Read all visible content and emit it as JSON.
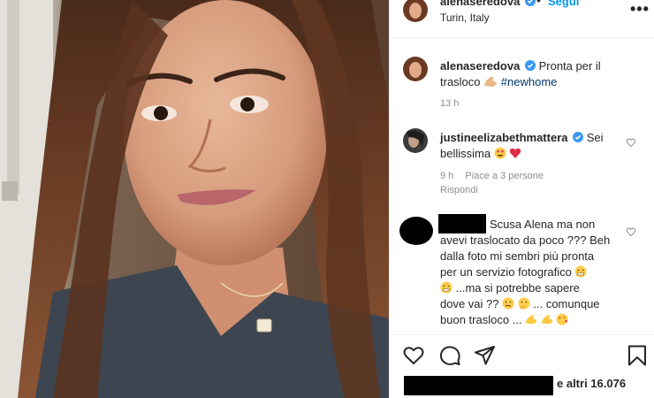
{
  "post": {
    "header": {
      "username": "alenaseredova",
      "separator": "•",
      "follow_label": "Segui",
      "location": "Turin, Italy",
      "more_label": "•••"
    },
    "caption": {
      "username": "alenaseredova",
      "text": "Pronta per il trasloco",
      "hashtag": "#newhome",
      "time": "13 h"
    },
    "comments": [
      {
        "username": "justineelizabethmattera",
        "text": "Sei bellissima",
        "time": "9 h",
        "likes": "Piace a 3 persone",
        "reply_label": "Rispondi"
      },
      {
        "text_line1": "Scusa Alena ma non",
        "text_line2": "avevi traslocato da poco ??? Beh",
        "text_line3": "dalla foto mi sembri più pronta",
        "text_line4": "per un servizio fotografico",
        "text_line5": "...ma si potrebbe sapere",
        "text_line6": "dove vai ??",
        "text_line6b": "... comunque",
        "text_line7": "buon trasloco ..."
      }
    ],
    "likes_suffix": "e altri 16.076"
  },
  "colors": {
    "link_blue": "#0095f6",
    "hashtag_blue": "#00376b",
    "muted_gray": "#8e8e8e",
    "verified_blue": "#3897f0",
    "heart_red": "#e0245e"
  },
  "icons": [
    "verified-badge-icon",
    "more-options-icon",
    "heart-icon",
    "comment-icon",
    "share-icon",
    "bookmark-icon",
    "flexed-biceps-emoji",
    "heart-eyes-emoji",
    "red-heart-emoji",
    "grimacing-emoji"
  ]
}
